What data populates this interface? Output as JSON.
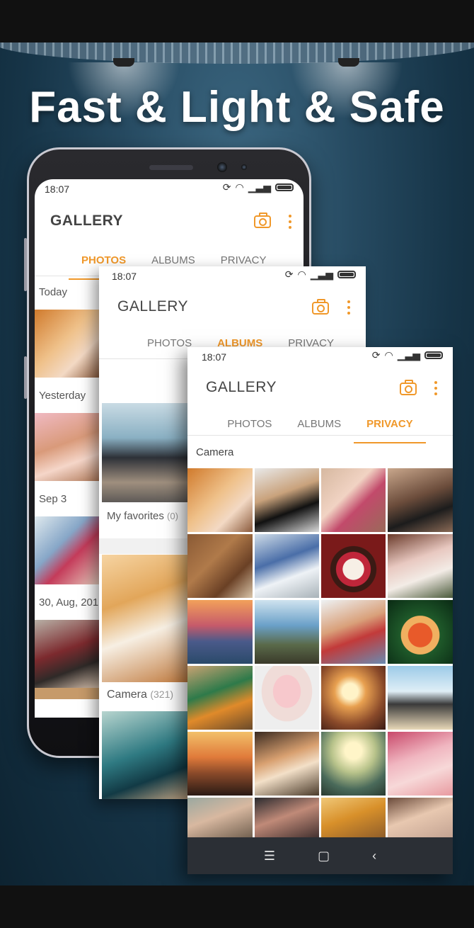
{
  "headline": "Fast & Light & Safe",
  "status": {
    "time": "18:07"
  },
  "app": {
    "title": "GALLERY"
  },
  "tabs": [
    "PHOTOS",
    "ALBUMS",
    "PRIVACY"
  ],
  "screen1": {
    "active_tab": "PHOTOS",
    "sections": [
      "Today",
      "Yesterday",
      "Sep 3",
      "30, Aug, 201"
    ]
  },
  "screen2": {
    "active_tab": "ALBUMS",
    "albums": [
      {
        "name": "My favorites",
        "count": "(0)"
      },
      {
        "name": "Camera",
        "count": "(321)"
      }
    ]
  },
  "screen3": {
    "active_tab": "PRIVACY",
    "section": "Camera"
  },
  "navbar": {
    "menu": "☰",
    "home": "▢",
    "back": "‹"
  },
  "colors": {
    "accent": "#f0982a",
    "navbar": "#2b2f35",
    "background": "#1f4257"
  },
  "icons": [
    "camera-icon",
    "more-vert-icon",
    "sync-icon",
    "wifi-icon",
    "signal-icon",
    "battery-icon"
  ]
}
